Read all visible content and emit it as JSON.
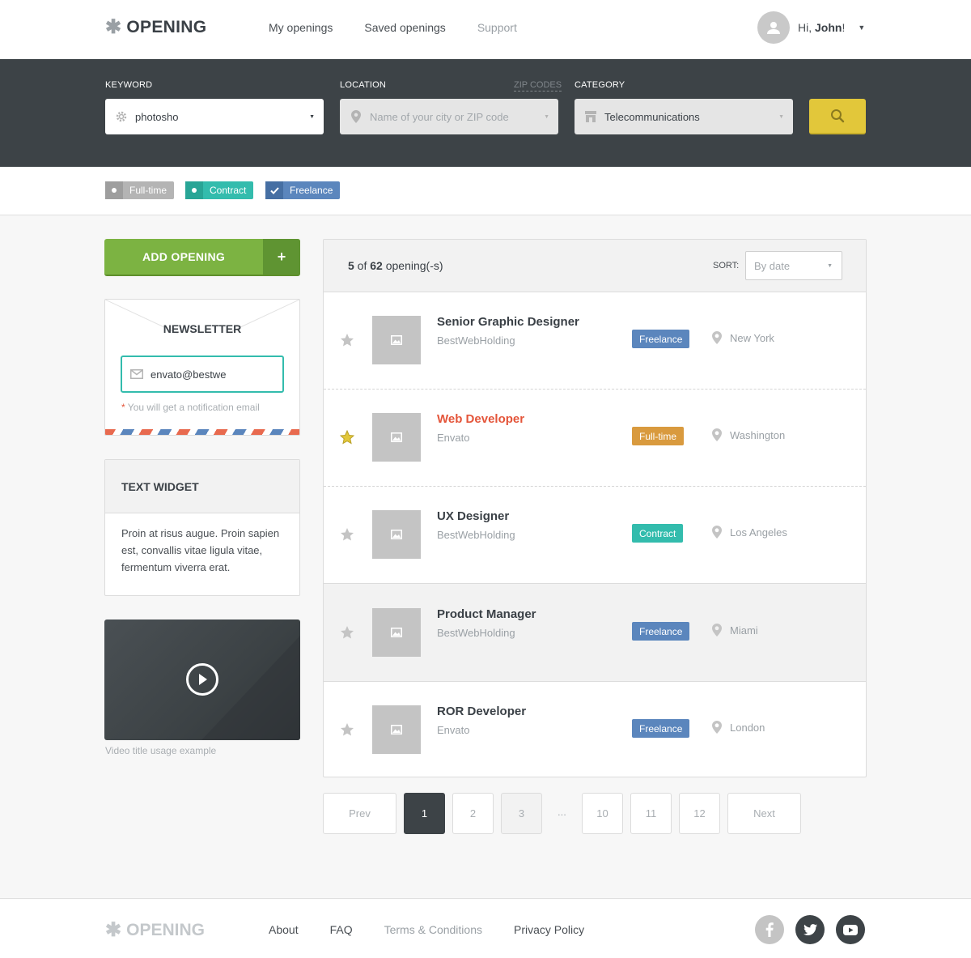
{
  "header": {
    "logo": "OPENING",
    "nav": [
      {
        "label": "My openings"
      },
      {
        "label": "Saved openings"
      },
      {
        "label": "Support"
      }
    ],
    "greeting_prefix": "Hi, ",
    "user_name": "John",
    "greeting_suffix": "!"
  },
  "search": {
    "keyword_label": "KEYWORD",
    "keyword_value": "photosho",
    "location_label": "LOCATION",
    "zip_link": "ZIP CODES",
    "location_placeholder": "Name of your city or ZIP code",
    "category_label": "CATEGORY",
    "category_value": "Telecommunications"
  },
  "filters": [
    {
      "label": "Full-time",
      "color": "#b4b4b4"
    },
    {
      "label": "Contract",
      "color": "#33bcad"
    },
    {
      "label": "Freelance",
      "color": "#5b86bd",
      "checked": true
    }
  ],
  "sidebar": {
    "add_button": "ADD OPENING",
    "add_plus": "+",
    "newsletter_title": "NEWSLETTER",
    "newsletter_email": "envato@bestwe",
    "newsletter_req": "*",
    "newsletter_note": " You will get a notification email",
    "widget_title": "TEXT WIDGET",
    "widget_body": "Proin at risus augue. Proin sapien est, convallis vitae ligula vitae, fermentum viverra erat.",
    "video_caption": "Video title usage example"
  },
  "listing": {
    "count_shown": "5",
    "count_of": " of ",
    "count_total": "62",
    "count_suffix": " opening(-s)",
    "sort_label": "SORT:",
    "sort_value": "By date",
    "rows": [
      {
        "title": "Senior Graphic Designer",
        "company": "BestWebHolding",
        "type": "Freelance",
        "location": "New York",
        "starred": false
      },
      {
        "title": "Web Developer",
        "company": "Envato",
        "type": "Full-time",
        "location": "Washington",
        "starred": true
      },
      {
        "title": "UX Designer",
        "company": "BestWebHolding",
        "type": "Contract",
        "location": "Los Angeles",
        "starred": false
      },
      {
        "title": "Product Manager",
        "company": "BestWebHolding",
        "type": "Freelance",
        "location": "Miami",
        "starred": false
      },
      {
        "title": "ROR Developer",
        "company": "Envato",
        "type": "Freelance",
        "location": "London",
        "starred": false
      }
    ]
  },
  "pagination": {
    "prev": "Prev",
    "pages": [
      "1",
      "2",
      "3",
      "10",
      "11",
      "12"
    ],
    "ellipsis": "...",
    "next": "Next",
    "current": "1"
  },
  "footer": {
    "logo": "OPENING",
    "links": [
      {
        "label": "About"
      },
      {
        "label": "FAQ"
      },
      {
        "label": "Terms & Conditions"
      },
      {
        "label": "Privacy Policy"
      }
    ],
    "social": [
      "facebook-icon",
      "twitter-icon",
      "youtube-icon"
    ]
  },
  "colors": {
    "accent_yellow": "#e2c73a",
    "green": "#7cb342",
    "dark": "#3d4347",
    "teal": "#33bcad",
    "blue": "#5b86bd",
    "orange": "#d99a3e",
    "red": "#e4553a"
  }
}
